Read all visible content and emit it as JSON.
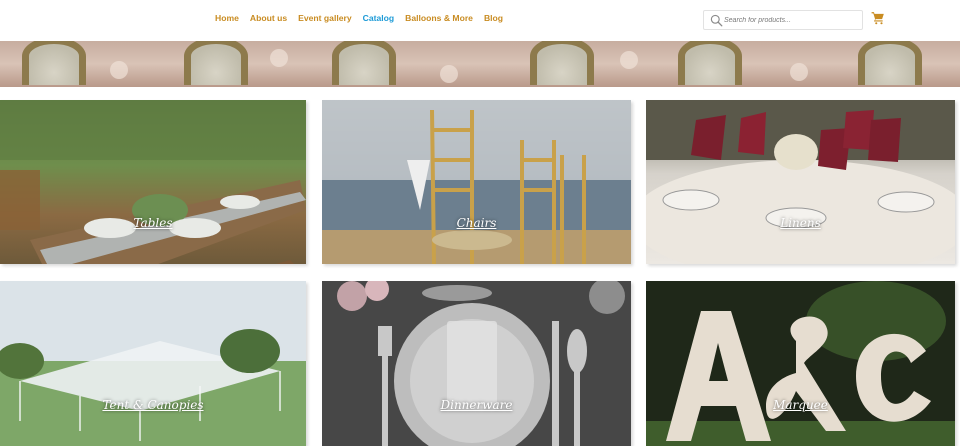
{
  "nav": {
    "items": [
      {
        "label": "Home",
        "active": false
      },
      {
        "label": "About us",
        "active": false
      },
      {
        "label": "Event gallery",
        "active": false
      },
      {
        "label": "Catalog",
        "active": true
      },
      {
        "label": "Balloons & More",
        "active": false
      },
      {
        "label": "Blog",
        "active": false
      }
    ]
  },
  "search": {
    "placeholder": "Search for products...",
    "value": ""
  },
  "icons": {
    "search": "search-icon",
    "cart": "cart-icon"
  },
  "colors": {
    "nav": "#c98c22",
    "nav_active": "#1e9bd7",
    "cart": "#c98c22"
  },
  "catalog": {
    "tiles": [
      {
        "label": "Tables"
      },
      {
        "label": "Chairs"
      },
      {
        "label": "Linens"
      },
      {
        "label": "Tent & Canopies"
      },
      {
        "label": "Dinnerware"
      },
      {
        "label": "Marquee"
      }
    ]
  }
}
